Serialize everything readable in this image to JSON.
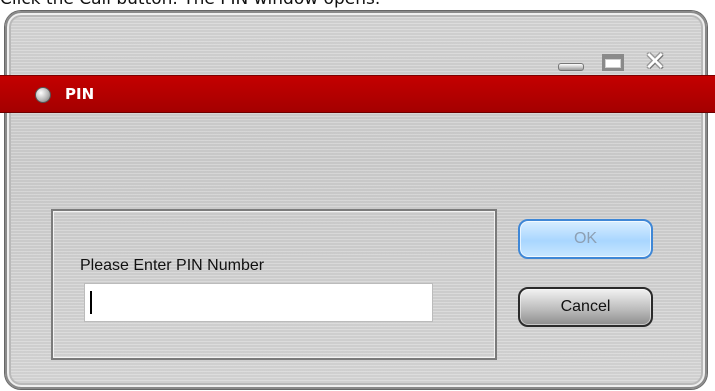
{
  "caption": "Click the Call button. The PIN window opens.",
  "window": {
    "title": "PIN",
    "controls": {
      "minimize_icon": "minimize-icon",
      "maximize_icon": "maximize-icon",
      "close_icon": "close-icon"
    },
    "header_color": "#b00000",
    "indicator_icon": "status-indicator-icon"
  },
  "form": {
    "prompt": "Please Enter PIN Number",
    "pin_value": ""
  },
  "buttons": {
    "ok_label": "OK",
    "cancel_label": "Cancel",
    "ok_color": "#a9d6ff",
    "cancel_color": "#b9b9b9"
  }
}
